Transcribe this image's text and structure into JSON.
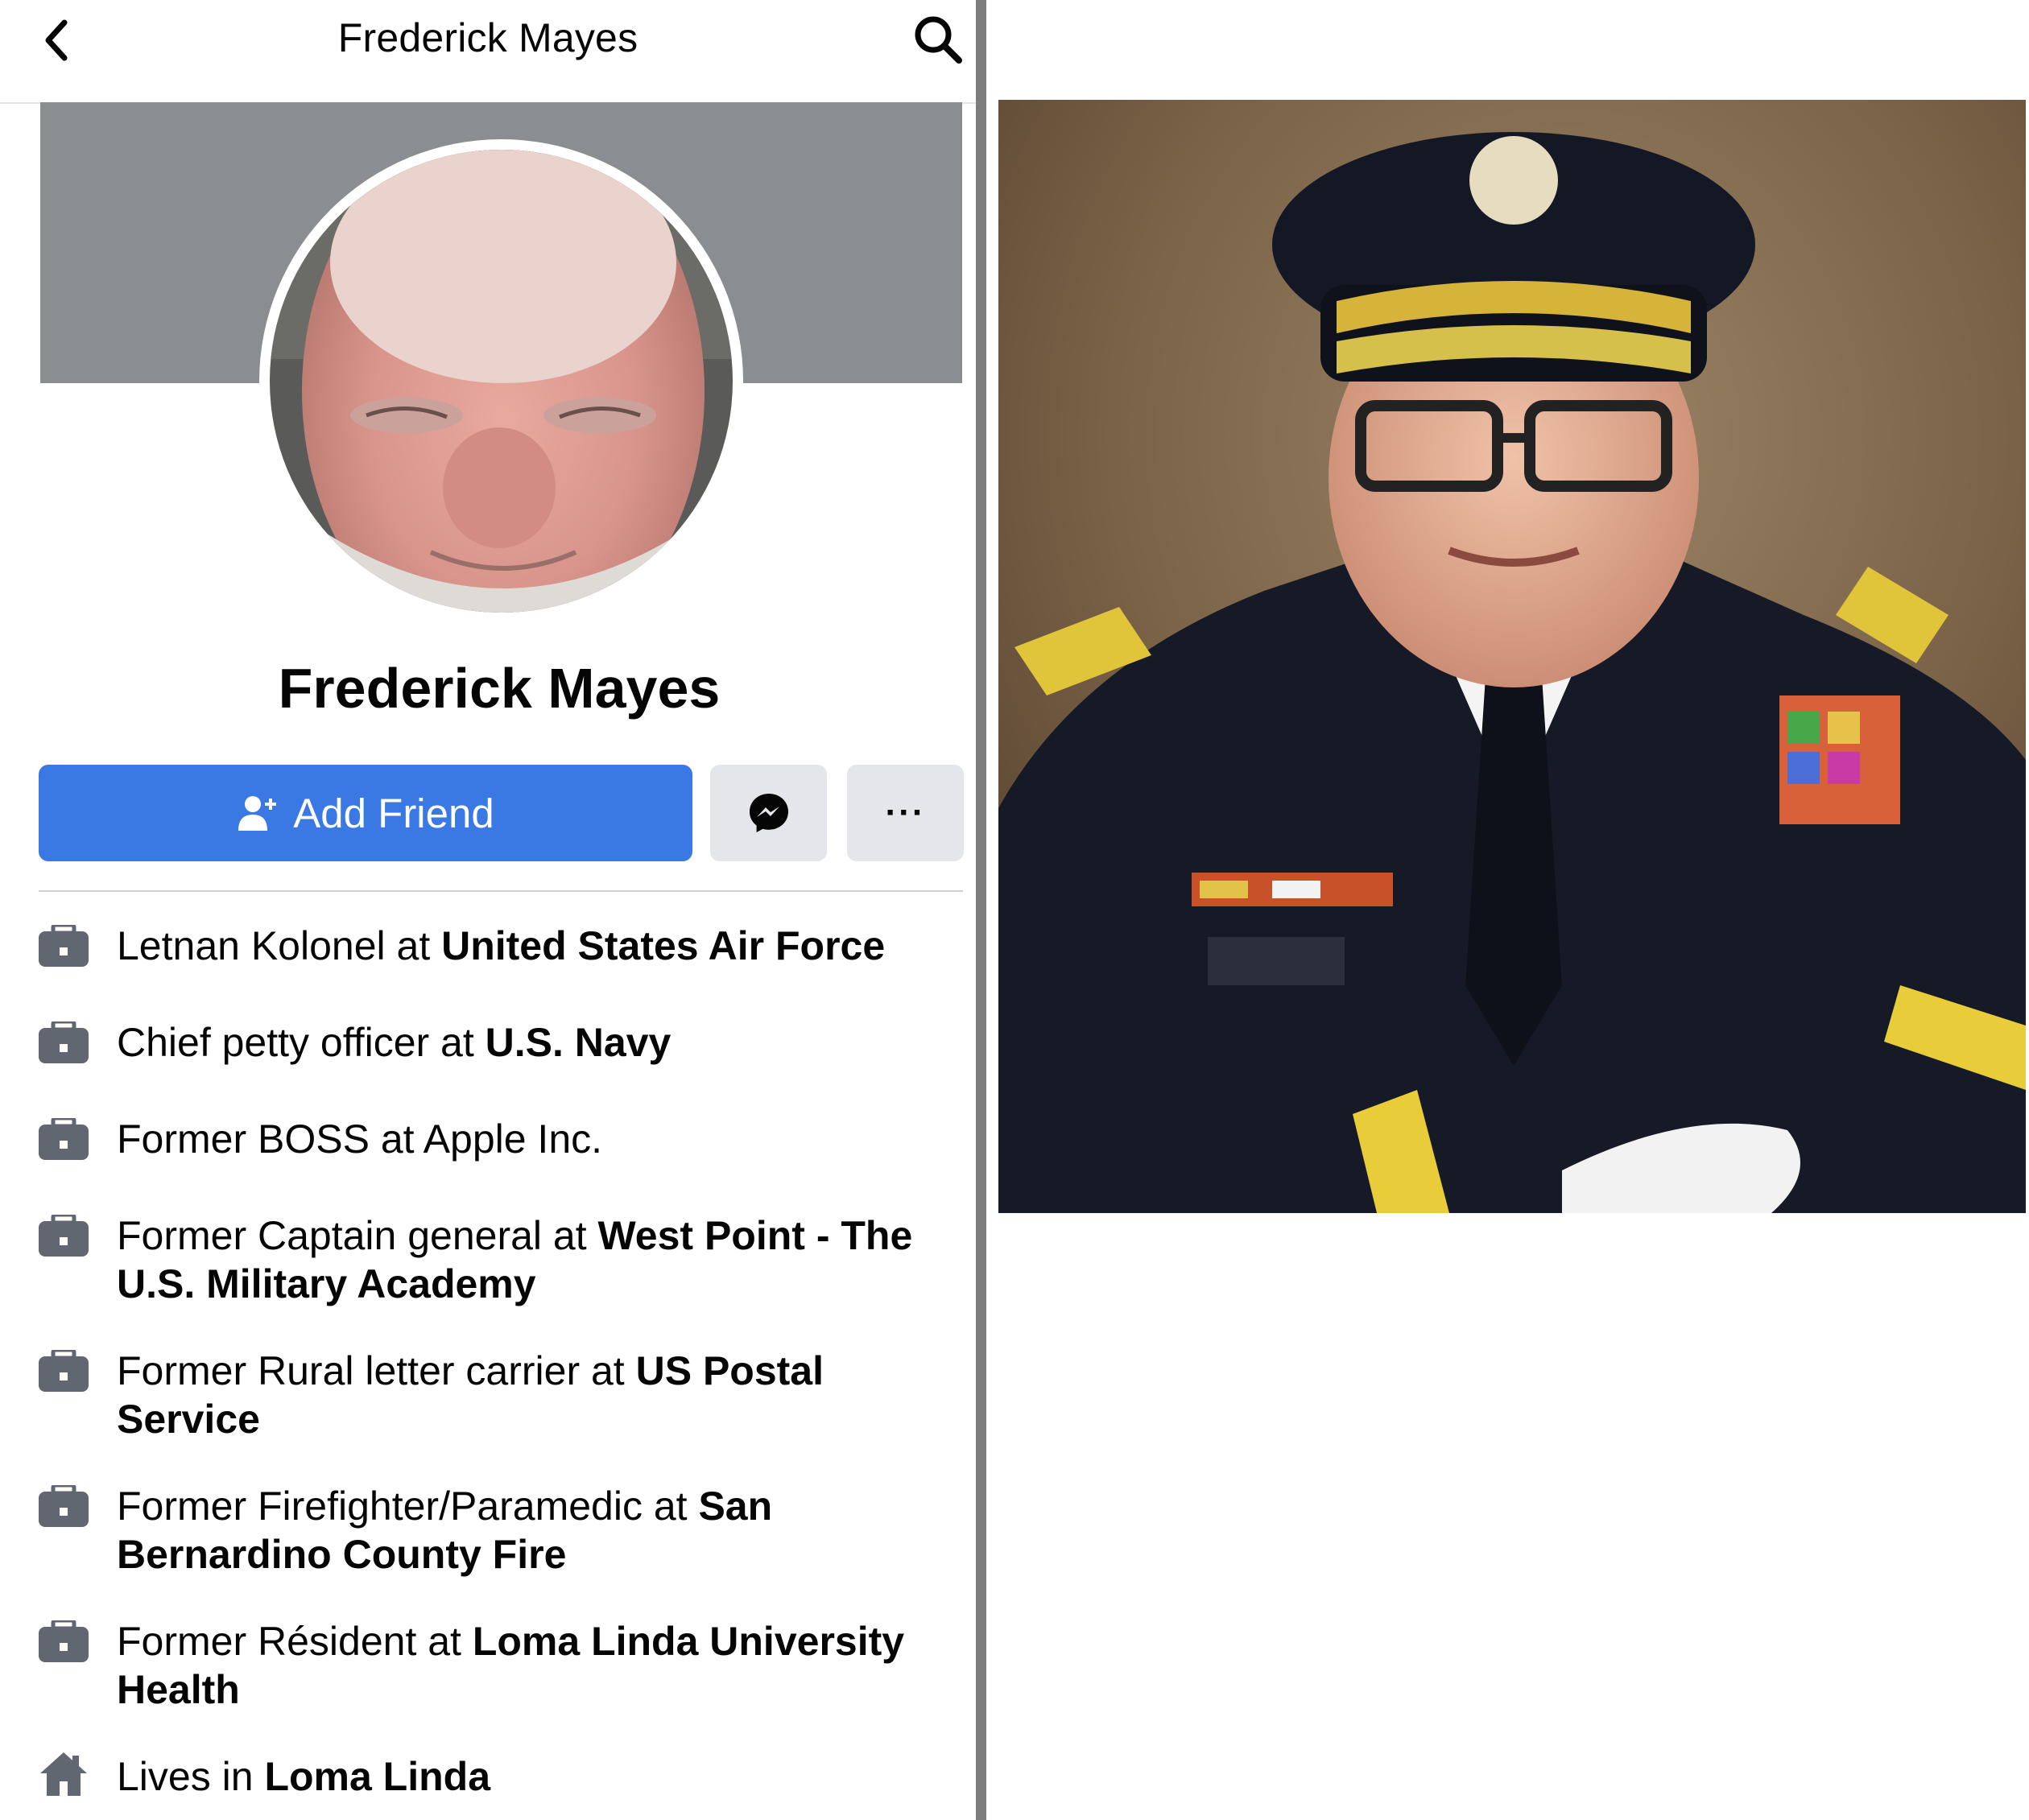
{
  "nav": {
    "title": "Frederick Mayes"
  },
  "profile": {
    "name": "Frederick Mayes",
    "add_friend_label": "Add Friend",
    "more_label": "···"
  },
  "info": [
    {
      "prefix": "Letnan Kolonel at ",
      "bold": "United States Air Force",
      "icon": "briefcase-icon"
    },
    {
      "prefix": "Chief petty officer at ",
      "bold": "U.S. Navy",
      "icon": "briefcase-icon"
    },
    {
      "prefix": "Former BOSS at Apple Inc.",
      "bold": "",
      "icon": "briefcase-icon"
    },
    {
      "prefix": "Former Captain general at ",
      "bold": "West Point - The U.S. Military Academy",
      "icon": "briefcase-icon"
    },
    {
      "prefix": "Former Rural letter carrier at ",
      "bold": "US Postal Service",
      "icon": "briefcase-icon"
    },
    {
      "prefix": "Former Firefighter/Paramedic at ",
      "bold": "San Bernardino County Fire",
      "icon": "briefcase-icon"
    },
    {
      "prefix": "Former Résident at ",
      "bold": "Loma Linda University Health",
      "icon": "briefcase-icon"
    },
    {
      "prefix": "Lives in ",
      "bold": "Loma Linda",
      "icon": "home-icon"
    }
  ],
  "colors": {
    "primary": "#3a78e3",
    "cover": "#8a8d91",
    "button_gray": "#e4e6eb"
  }
}
